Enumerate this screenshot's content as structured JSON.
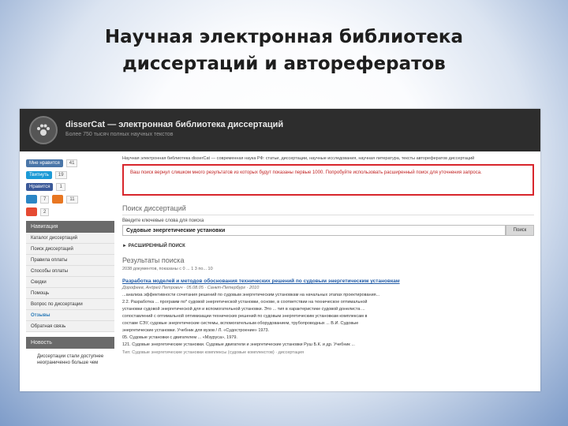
{
  "slide": {
    "title_line1": "Научная электронная библиотека",
    "title_line2": "диссертаций и авторефератов"
  },
  "site": {
    "title": "disserCat — электронная библиотека диссертаций",
    "subtitle": "Более 750 тысяч полных научных текстов"
  },
  "social": {
    "row1": {
      "label": "Мне нравится",
      "count": "41"
    },
    "row2": {
      "label": "Твитнуть",
      "count": "19"
    },
    "row3": {
      "label": "Нравится",
      "count": "1"
    },
    "row4": {
      "count_a": "7",
      "count_b": "11"
    },
    "row5": {
      "count": "2"
    }
  },
  "navigation": {
    "header": "Навигация",
    "items": [
      "Каталог диссертаций",
      "Поиск диссертаций",
      "Правила оплаты",
      "Способы оплаты",
      "Скидки",
      "Помощь",
      "Вопрос по диссертации",
      "Отзывы",
      "Обратная связь"
    ],
    "footer_header": "Новость",
    "footer_text": "Диссертации стали доступнее неограниченно больше чем"
  },
  "main": {
    "breadcrumb": "Научная электронная библиотека disserCat — современная наука РФ: статьи, диссертации, научные исследования, научная литература, тексты авторефератов диссертаций",
    "alert": "Ваш поиск вернул слишком много результатов из которых будут показаны первые 1000. Попробуйте использовать расширенный поиск для уточнения запроса.",
    "search_section_title": "Поиск диссертаций",
    "field_label": "Введите ключевые слова для поиска",
    "search_value": "Судовые энергетические установки",
    "search_button": "Поиск",
    "advanced_label": "► РАСШИРЕННЫЙ ПОИСК",
    "results_title": "Результаты поиска",
    "results_meta": "2038 документов, показаны с 0 ... 1 3 по... 10",
    "result": {
      "title": "Разработка моделей и методов обоснования технических решений по судовым энергетическим установкам",
      "author": "Дорофеев, Андрей Петрович · 05.08.05 · Санкт-Петербург · 2010",
      "lines": [
        "...анализа эффективности сочетания решений по судовым энергетическим установкам на начальных этапах проектирования...",
        "2.2. Разработка ... программ по* судовой энергетической установки, основе, в соответствии на техническое оптимальной",
        "установки судовой энергетической для и вспомогательной установки. Это ... тип в характеристике судовой донелиста ...",
        "сопоставлений с оптимальной оптимизации технических решений по судовым энергетическим установкам комплексам в",
        "составе СЭУ, судовые энергетические системы, вспомогательным оборудованием, трубопроводных ... В.И. Судовые",
        "энергетические установки. Учебник для вузов / Л. «Судостроение» 1973.",
        "05. Судовые установки с двигателем ... «Мзуруса», 1979.",
        "121. Судовые энергетические установки. Судовые двигатели и энергетические установки Руш Б.К. и др. Учебник ..."
      ],
      "footer": "Тип: Судовые энергетические установки комплексы (судовые комплекстов) · диссертация"
    }
  },
  "colors": {
    "topbar": "#2d2d2d",
    "alert_border": "#d8262c",
    "link": "#1f5aa6",
    "nav_header": "#6a6a6a"
  }
}
